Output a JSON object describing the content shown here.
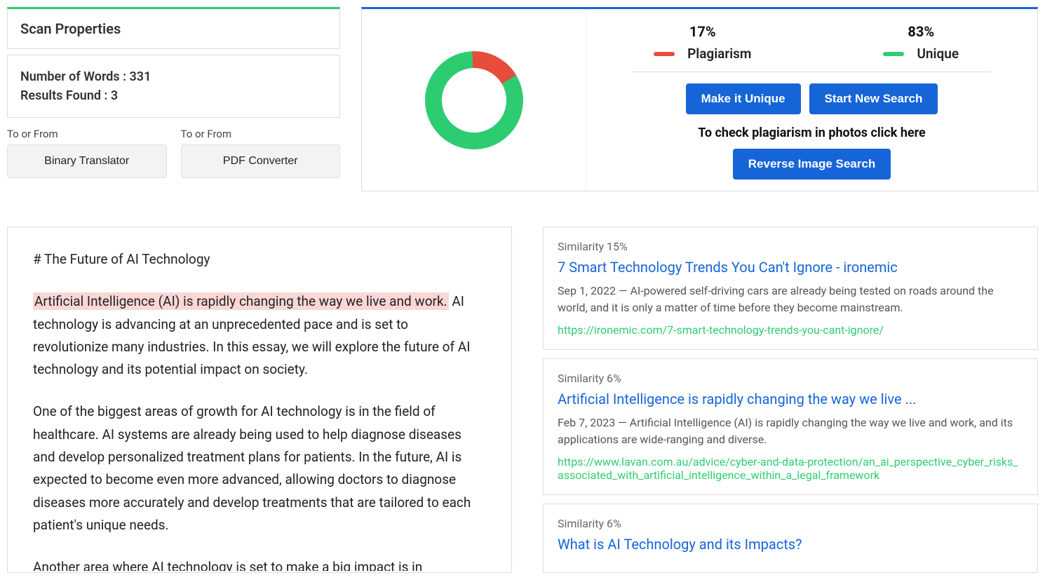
{
  "scan": {
    "title": "Scan Properties",
    "words_label": "Number of Words :",
    "words_value": "331",
    "results_label": "Results Found :",
    "results_value": "3"
  },
  "tools": {
    "label_a": "To or From",
    "btn_a": "Binary Translator",
    "label_b": "To or From",
    "btn_b": "PDF Converter"
  },
  "summary": {
    "plag_pct": "17%",
    "plag_label": "Plagiarism",
    "unique_pct": "83%",
    "unique_label": "Unique",
    "btn_make_unique": "Make it Unique",
    "btn_new_search": "Start New Search",
    "photo_text": "To check plagiarism in photos click here",
    "btn_reverse": "Reverse Image Search"
  },
  "chart_data": {
    "type": "pie",
    "title": "",
    "series": [
      {
        "name": "Plagiarism",
        "value": 17,
        "color": "#e74c3c"
      },
      {
        "name": "Unique",
        "value": 83,
        "color": "#2ecc71"
      }
    ]
  },
  "essay": {
    "title": "# The Future of AI Technology",
    "highlight": "Artificial Intelligence (AI) is rapidly changing the way we live and work.",
    "p1_rest": " AI technology is advancing at an unprecedented pace and is set to revolutionize many industries. In this essay, we will explore the future of AI technology and its potential impact on society.",
    "p2": "One of the biggest areas of growth for AI technology is in the field of healthcare. AI systems are already being used to help diagnose diseases and develop personalized treatment plans for patients. In the future, AI is expected to become even more advanced, allowing doctors to diagnose diseases more accurately and develop treatments that are tailored to each patient's unique needs.",
    "p3": "Another area where AI technology is set to make a big impact is in"
  },
  "results": [
    {
      "similarity": "Similarity 15%",
      "title": "7 Smart Technology Trends You Can't Ignore - ironemic",
      "desc": "Sep 1, 2022 — AI-powered self-driving cars are already being tested on roads around the world, and it is only a matter of time before they become mainstream.",
      "url": "https://ironemic.com/7-smart-technology-trends-you-cant-ignore/"
    },
    {
      "similarity": "Similarity 6%",
      "title": "Artificial Intelligence is rapidly changing the way we live ...",
      "desc": "Feb 7, 2023 — Artificial Intelligence (AI) is rapidly changing the way we live and work, and its applications are wide-ranging and diverse.",
      "url": "https://www.lavan.com.au/advice/cyber-and-data-protection/an_ai_perspective_cyber_risks_associated_with_artificial_intelligence_within_a_legal_framework"
    },
    {
      "similarity": "Similarity 6%",
      "title": "What is AI Technology and its Impacts?",
      "desc": "",
      "url": ""
    }
  ]
}
